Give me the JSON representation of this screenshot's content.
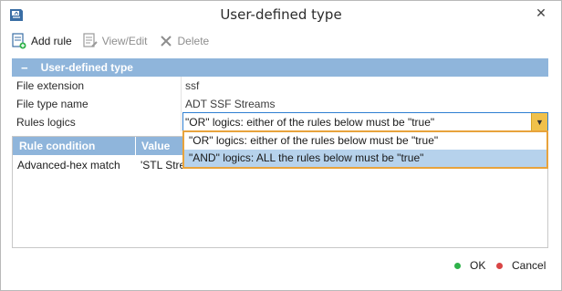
{
  "window": {
    "title": "User-defined type",
    "close_glyph": "✕",
    "app_icon": "app-logo-icon"
  },
  "toolbar": {
    "add_rule": "Add rule",
    "view_edit": "View/Edit",
    "delete": "Delete"
  },
  "properties": {
    "group_title": "User-defined type",
    "group_toggle": "−",
    "rows": [
      {
        "key": "File extension",
        "value": "ssf"
      },
      {
        "key": "File type name",
        "value": "ADT SSF Streams"
      },
      {
        "key": "Rules logics",
        "value": "\"OR\" logics: either of the rules below must be \"true\""
      }
    ]
  },
  "combo": {
    "value": "\"OR\" logics: either of the rules below must be \"true\"",
    "arrow": "▼"
  },
  "dropdown": {
    "options": [
      "\"OR\" logics: either of the rules below must be \"true\"",
      "\"AND\" logics: ALL the rules below must be \"true\""
    ],
    "selected_index": 1
  },
  "rules_table": {
    "columns": [
      "Rule condition",
      "Value"
    ],
    "rows": [
      {
        "condition": "Advanced-hex match",
        "value": "'STL Strea"
      }
    ]
  },
  "footer": {
    "ok": "OK",
    "cancel": "Cancel"
  },
  "colors": {
    "header_blue": "#8fb5db",
    "selection_blue": "#b6d2ec",
    "dropdown_border": "#e8a33c",
    "ok_dot": "#2fb24a",
    "cancel_dot": "#d94545"
  }
}
